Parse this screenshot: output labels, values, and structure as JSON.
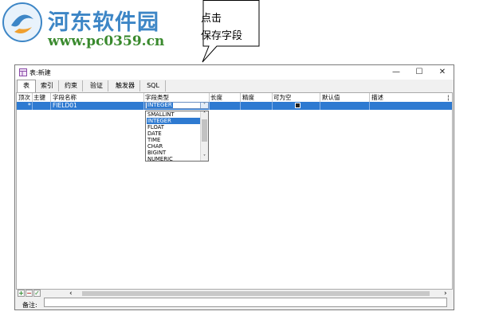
{
  "watermark": {
    "site_name": "河东软件园",
    "url": "www.pc0359.cn"
  },
  "callout": {
    "line1": "点击",
    "line2": "保存字段"
  },
  "window": {
    "title": "表:新建",
    "controls": {
      "minimize": "—",
      "maximize": "☐",
      "close": "✕"
    },
    "tabs": [
      "表",
      "索引",
      "约束",
      "验证",
      "触发器",
      "SQL"
    ],
    "active_tab": "表"
  },
  "grid": {
    "columns": [
      "顶次",
      "主键",
      "字段名称",
      "字段类型",
      "长度",
      "精度",
      "可为空",
      "默认值",
      "描述"
    ],
    "rows": [
      {
        "marker": "*",
        "primary_key": "",
        "field_name": "FIELD01",
        "field_type": "INTEGER",
        "length": "",
        "precision": "",
        "nullable": true,
        "default": "",
        "description": ""
      }
    ]
  },
  "type_dropdown": {
    "selected": "INTEGER",
    "options": [
      "SMALLINT",
      "INTEGER",
      "FLOAT",
      "DATE",
      "TIME",
      "CHAR",
      "BIGINT",
      "NUMERIC"
    ]
  },
  "toolbar": {
    "add": "+",
    "remove": "−",
    "confirm": "✓"
  },
  "scroll": {
    "left_arrow": "‹",
    "right_arrow": "›",
    "up_arrow": "˄",
    "down_arrow": "˅"
  },
  "remark": {
    "label": "备注:",
    "value": ""
  },
  "colors": {
    "selection": "#2e7ad1",
    "watermark_blue": "#3d86c6",
    "watermark_green": "#3a8a2e"
  }
}
